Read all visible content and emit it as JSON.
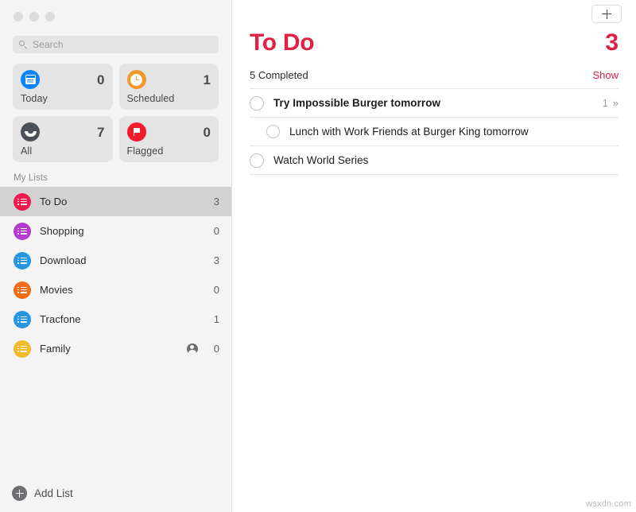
{
  "accent_color": "#e02044",
  "window": {
    "traffic_lights": [
      "close",
      "minimize",
      "zoom"
    ]
  },
  "sidebar": {
    "search": {
      "placeholder": "Search",
      "value": ""
    },
    "smart_lists": [
      {
        "label": "Today",
        "count": "0",
        "icon": "calendar-icon",
        "color": "#0a84ff"
      },
      {
        "label": "Scheduled",
        "count": "1",
        "icon": "clock-icon",
        "color": "#f0992a"
      },
      {
        "label": "All",
        "count": "7",
        "icon": "tray-icon",
        "color": "#4c5057"
      },
      {
        "label": "Flagged",
        "count": "0",
        "icon": "flag-icon",
        "color": "#f01c2a"
      }
    ],
    "section_title": "My Lists",
    "lists": [
      {
        "label": "To Do",
        "count": "3",
        "color": "#ef1b4e",
        "selected": true,
        "shared": false
      },
      {
        "label": "Shopping",
        "count": "0",
        "color": "#b33ccc",
        "selected": false,
        "shared": false
      },
      {
        "label": "Download",
        "count": "3",
        "color": "#2596e3",
        "selected": false,
        "shared": false
      },
      {
        "label": "Movies",
        "count": "0",
        "color": "#ef6c18",
        "selected": false,
        "shared": false
      },
      {
        "label": "Tracfone",
        "count": "1",
        "color": "#2596e3",
        "selected": false,
        "shared": false
      },
      {
        "label": "Family",
        "count": "0",
        "color": "#f5b82e",
        "selected": false,
        "shared": true
      }
    ],
    "add_list_label": "Add List"
  },
  "main": {
    "add_button": "+",
    "title": "To Do",
    "count": "3",
    "completed_text": "5 Completed",
    "show_label": "Show",
    "reminders": [
      {
        "text": "Try Impossible Burger tomorrow",
        "bold": true,
        "sub": false,
        "subtask_count": "1",
        "chevron": "»"
      },
      {
        "text": "Lunch with Work Friends at Burger King tomorrow",
        "bold": false,
        "sub": true,
        "subtask_count": "",
        "chevron": ""
      },
      {
        "text": "Watch World Series",
        "bold": false,
        "sub": false,
        "subtask_count": "",
        "chevron": ""
      }
    ]
  },
  "watermark": "wsxdn.com"
}
